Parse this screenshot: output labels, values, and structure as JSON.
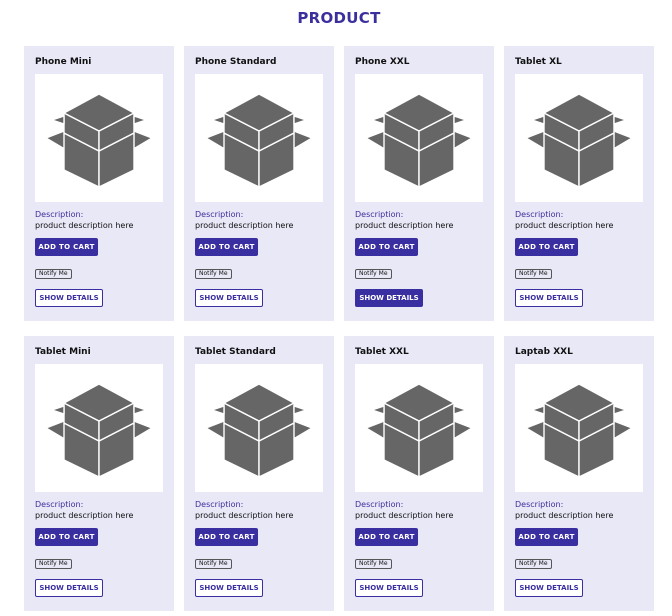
{
  "page": {
    "title": "PRODUCT"
  },
  "colors": {
    "accent": "#3a2fa0",
    "card_bg": "#e9e8f7",
    "icon_fill": "#666666"
  },
  "common": {
    "description_label": "Description:",
    "description_text": "product description here",
    "add_to_cart_label": "ADD TO CART",
    "notify_label": "Notify Me",
    "show_details_label": "SHOW DETAILS",
    "image_icon": "box-icon"
  },
  "products": [
    {
      "name": "Phone Mini",
      "details_active": false
    },
    {
      "name": "Phone Standard",
      "details_active": false
    },
    {
      "name": "Phone XXL",
      "details_active": true
    },
    {
      "name": "Tablet XL",
      "details_active": false
    },
    {
      "name": "Tablet Mini",
      "details_active": false
    },
    {
      "name": "Tablet Standard",
      "details_active": false
    },
    {
      "name": "Tablet XXL",
      "details_active": false
    },
    {
      "name": "Laptab XXL",
      "details_active": false
    }
  ]
}
